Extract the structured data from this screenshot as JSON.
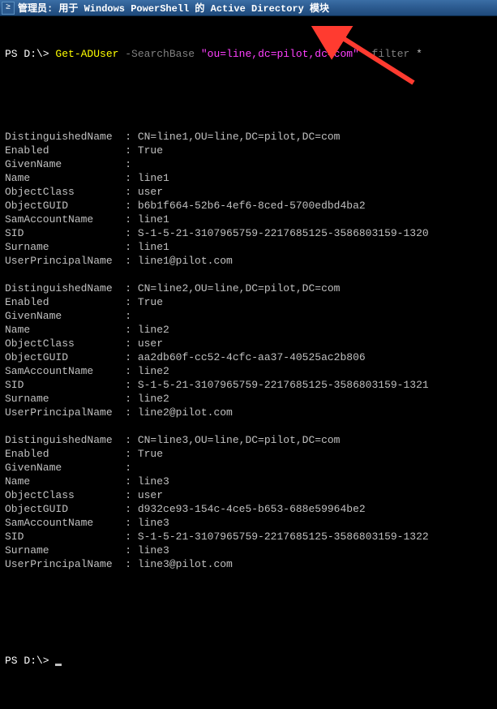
{
  "window": {
    "icon_glyph": "≥",
    "title": "管理员: 用于 Windows PowerShell 的 Active Directory 模块"
  },
  "prompt": {
    "path": "PS D:\\> ",
    "cmd": "Get-ADUser ",
    "flag1": "-SearchBase ",
    "arg1": "\"ou=line,dc=pilot,dc=com\" ",
    "flag2": "-filter ",
    "arg2": "*"
  },
  "fields": {
    "dn": "DistinguishedName  :",
    "enabled": "Enabled            :",
    "givenname": "GivenName          :",
    "name": "Name               :",
    "objclass": "ObjectClass        :",
    "objguid": "ObjectGUID         :",
    "sam": "SamAccountName     :",
    "sid": "SID                :",
    "surname": "Surname            :",
    "upn": "UserPrincipalName  :"
  },
  "records": [
    {
      "dn": " CN=line1,OU=line,DC=pilot,DC=com",
      "enabled": " True",
      "givenname": "",
      "name": " line1",
      "objclass": " user",
      "objguid": " b6b1f664-52b6-4ef6-8ced-5700edbd4ba2",
      "sam": " line1",
      "sid": " S-1-5-21-3107965759-2217685125-3586803159-1320",
      "surname": " line1",
      "upn": " line1@pilot.com"
    },
    {
      "dn": " CN=line2,OU=line,DC=pilot,DC=com",
      "enabled": " True",
      "givenname": "",
      "name": " line2",
      "objclass": " user",
      "objguid": " aa2db60f-cc52-4cfc-aa37-40525ac2b806",
      "sam": " line2",
      "sid": " S-1-5-21-3107965759-2217685125-3586803159-1321",
      "surname": " line2",
      "upn": " line2@pilot.com"
    },
    {
      "dn": " CN=line3,OU=line,DC=pilot,DC=com",
      "enabled": " True",
      "givenname": "",
      "name": " line3",
      "objclass": " user",
      "objguid": " d932ce93-154c-4ce5-b653-688e59964be2",
      "sam": " line3",
      "sid": " S-1-5-21-3107965759-2217685125-3586803159-1322",
      "surname": " line3",
      "upn": " line3@pilot.com"
    }
  ],
  "prompt_end": "PS D:\\> ",
  "arrow_color": "#ff3b30"
}
